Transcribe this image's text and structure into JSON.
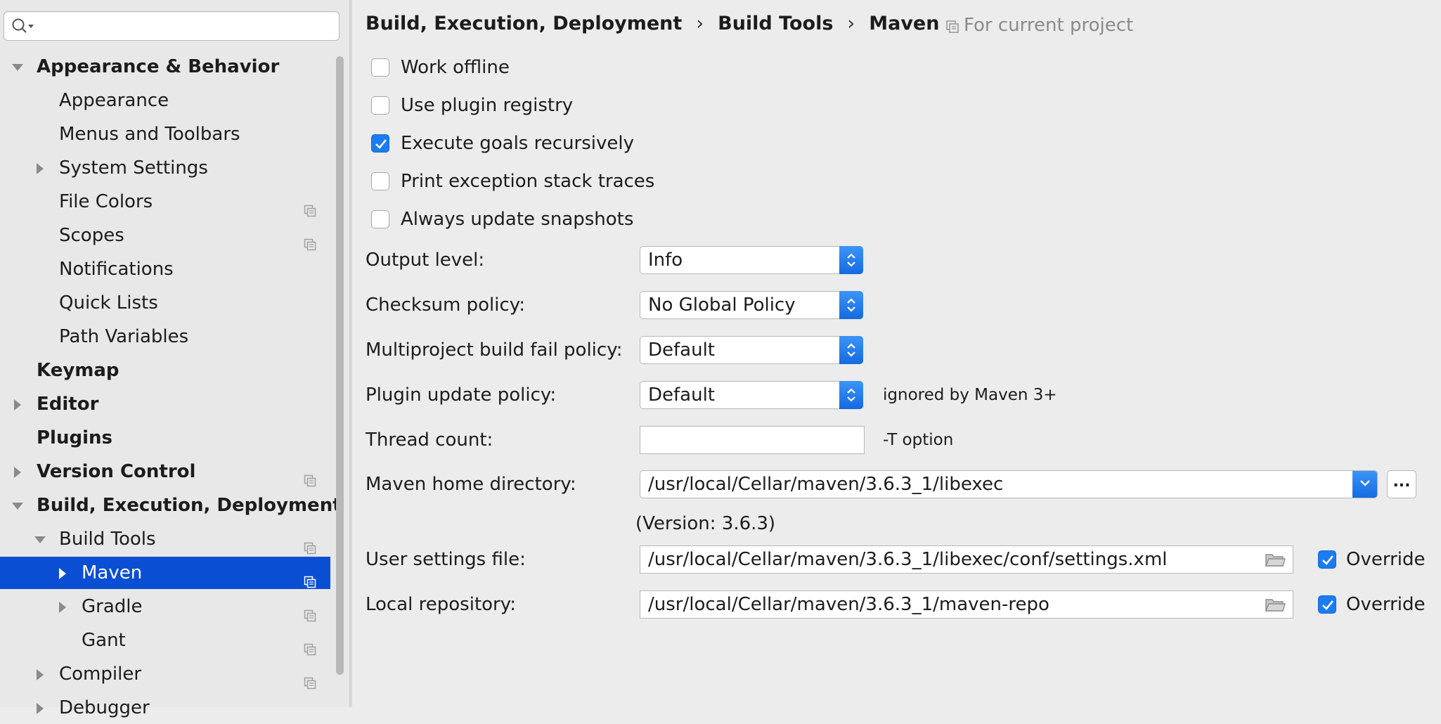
{
  "search": {
    "placeholder": ""
  },
  "sidebar": {
    "items": [
      {
        "label": "Appearance & Behavior",
        "indent": 0,
        "bold": true,
        "arrow": "down",
        "project": false,
        "selected": false
      },
      {
        "label": "Appearance",
        "indent": 1,
        "bold": false,
        "arrow": "none",
        "project": false,
        "selected": false
      },
      {
        "label": "Menus and Toolbars",
        "indent": 1,
        "bold": false,
        "arrow": "none",
        "project": false,
        "selected": false
      },
      {
        "label": "System Settings",
        "indent": 1,
        "bold": false,
        "arrow": "right",
        "project": false,
        "selected": false
      },
      {
        "label": "File Colors",
        "indent": 1,
        "bold": false,
        "arrow": "none",
        "project": true,
        "selected": false
      },
      {
        "label": "Scopes",
        "indent": 1,
        "bold": false,
        "arrow": "none",
        "project": true,
        "selected": false
      },
      {
        "label": "Notifications",
        "indent": 1,
        "bold": false,
        "arrow": "none",
        "project": false,
        "selected": false
      },
      {
        "label": "Quick Lists",
        "indent": 1,
        "bold": false,
        "arrow": "none",
        "project": false,
        "selected": false
      },
      {
        "label": "Path Variables",
        "indent": 1,
        "bold": false,
        "arrow": "none",
        "project": false,
        "selected": false
      },
      {
        "label": "Keymap",
        "indent": 0,
        "bold": true,
        "arrow": "none",
        "project": false,
        "selected": false
      },
      {
        "label": "Editor",
        "indent": 0,
        "bold": true,
        "arrow": "right",
        "project": false,
        "selected": false
      },
      {
        "label": "Plugins",
        "indent": 0,
        "bold": true,
        "arrow": "none",
        "project": false,
        "selected": false
      },
      {
        "label": "Version Control",
        "indent": 0,
        "bold": true,
        "arrow": "right",
        "project": true,
        "selected": false
      },
      {
        "label": "Build, Execution, Deployment",
        "indent": 0,
        "bold": true,
        "arrow": "down",
        "project": false,
        "selected": false
      },
      {
        "label": "Build Tools",
        "indent": 1,
        "bold": false,
        "arrow": "down",
        "project": true,
        "selected": false
      },
      {
        "label": "Maven",
        "indent": 2,
        "bold": false,
        "arrow": "right",
        "project": true,
        "selected": true
      },
      {
        "label": "Gradle",
        "indent": 2,
        "bold": false,
        "arrow": "right",
        "project": true,
        "selected": false
      },
      {
        "label": "Gant",
        "indent": 2,
        "bold": false,
        "arrow": "none",
        "project": true,
        "selected": false
      },
      {
        "label": "Compiler",
        "indent": 1,
        "bold": false,
        "arrow": "right",
        "project": true,
        "selected": false
      },
      {
        "label": "Debugger",
        "indent": 1,
        "bold": false,
        "arrow": "right",
        "project": false,
        "selected": false
      }
    ]
  },
  "breadcrumb": {
    "items": [
      "Build, Execution, Deployment",
      "Build Tools",
      "Maven"
    ],
    "separator": "›",
    "scope": "For current project"
  },
  "checkboxes": [
    {
      "label": "Work offline",
      "checked": false
    },
    {
      "label": "Use plugin registry",
      "checked": false
    },
    {
      "label": "Execute goals recursively",
      "checked": true
    },
    {
      "label": "Print exception stack traces",
      "checked": false
    },
    {
      "label": "Always update snapshots",
      "checked": false
    }
  ],
  "fields": {
    "output_level": {
      "label": "Output level:",
      "value": "Info"
    },
    "checksum_policy": {
      "label": "Checksum policy:",
      "value": "No Global Policy"
    },
    "fail_policy": {
      "label": "Multiproject build fail policy:",
      "value": "Default"
    },
    "plugin_update": {
      "label": "Plugin update policy:",
      "value": "Default",
      "hint": "ignored by Maven 3+"
    },
    "thread_count": {
      "label": "Thread count:",
      "value": "",
      "hint": "-T option"
    },
    "maven_home": {
      "label": "Maven home directory:",
      "value": "/usr/local/Cellar/maven/3.6.3_1/libexec",
      "version": "(Version: 3.6.3)",
      "browse": "..."
    },
    "user_settings": {
      "label": "User settings file:",
      "value": "/usr/local/Cellar/maven/3.6.3_1/libexec/conf/settings.xml",
      "override_label": "Override",
      "override": true
    },
    "local_repo": {
      "label": "Local repository:",
      "value": "/usr/local/Cellar/maven/3.6.3_1/maven-repo",
      "override_label": "Override",
      "override": true
    }
  },
  "colors": {
    "accent": "#1a7cf0",
    "selection": "#0a4fd3"
  }
}
